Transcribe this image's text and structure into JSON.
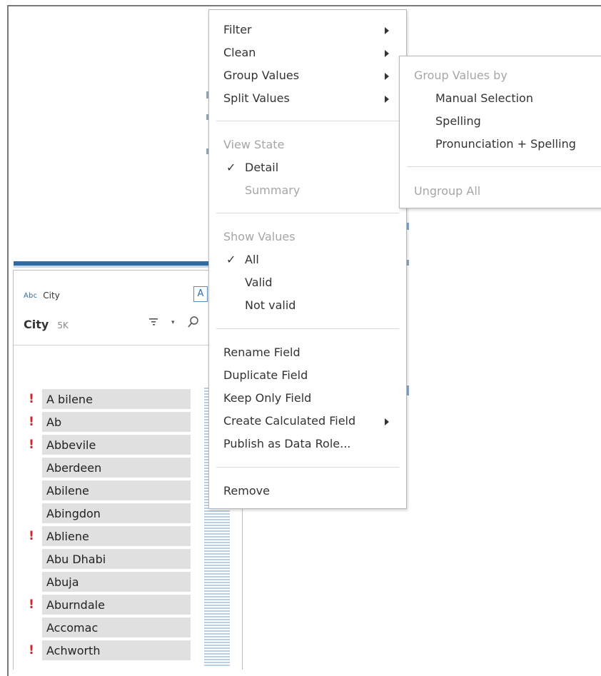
{
  "menu": {
    "filter": "Filter",
    "clean": "Clean",
    "group_values": "Group Values",
    "split_values": "Split Values",
    "view_state_header": "View State",
    "detail": "Detail",
    "summary": "Summary",
    "show_values_header": "Show Values",
    "all": "All",
    "valid": "Valid",
    "not_valid": "Not valid",
    "rename_field": "Rename Field",
    "duplicate_field": "Duplicate Field",
    "keep_only_field": "Keep Only Field",
    "create_calculated_field": "Create Calculated Field",
    "publish_as_data_role": "Publish as Data Role...",
    "remove": "Remove",
    "checkmark": "✓"
  },
  "submenu": {
    "header": "Group Values by",
    "manual_selection": "Manual Selection",
    "spelling": "Spelling",
    "pronunciation_spelling": "Pronunciation + Spelling",
    "ungroup_all": "Ungroup All"
  },
  "profile_card": {
    "type_icon": "Abc",
    "field_small_name": "City",
    "field_title": "City",
    "field_count": "5K",
    "type_toggle": "A",
    "sort_icon": "sort-icon",
    "search_icon": "search-icon"
  },
  "values": [
    {
      "label": "A bilene",
      "invalid": true
    },
    {
      "label": "Ab",
      "invalid": true
    },
    {
      "label": "Abbevile",
      "invalid": true
    },
    {
      "label": "Aberdeen",
      "invalid": false
    },
    {
      "label": "Abilene",
      "invalid": false
    },
    {
      "label": "Abingdon",
      "invalid": false
    },
    {
      "label": "Abliene",
      "invalid": true
    },
    {
      "label": "Abu Dhabi",
      "invalid": false
    },
    {
      "label": "Abuja",
      "invalid": false
    },
    {
      "label": "Aburndale",
      "invalid": true
    },
    {
      "label": "Accomac",
      "invalid": false
    },
    {
      "label": "Achworth",
      "invalid": true
    }
  ],
  "warning_glyph": "!",
  "colors": {
    "accent": "#2e6da4",
    "warning": "#d0262d",
    "value_cell_bg": "#e0e0e0",
    "disabled_text": "#a6a6a6"
  }
}
